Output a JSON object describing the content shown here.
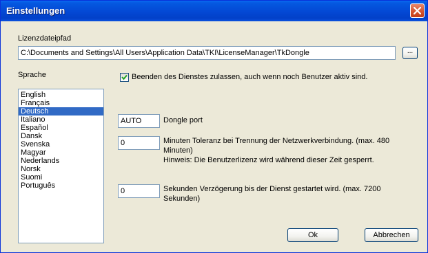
{
  "window": {
    "title": "Einstellungen"
  },
  "license": {
    "label": "Lizenzdateipfad",
    "path": "C:\\Documents and Settings\\All Users\\Application Data\\TKI\\LicenseManager\\TkDongle",
    "browse_label": "..."
  },
  "language": {
    "label": "Sprache",
    "items": [
      {
        "label": "English",
        "selected": false
      },
      {
        "label": "Français",
        "selected": false
      },
      {
        "label": "Deutsch",
        "selected": true
      },
      {
        "label": "Italiano",
        "selected": false
      },
      {
        "label": "Español",
        "selected": false
      },
      {
        "label": "Dansk",
        "selected": false
      },
      {
        "label": "Svenska",
        "selected": false
      },
      {
        "label": "Magyar",
        "selected": false
      },
      {
        "label": "Nederlands",
        "selected": false
      },
      {
        "label": "Norsk",
        "selected": false
      },
      {
        "label": "Suomi",
        "selected": false
      },
      {
        "label": "Português",
        "selected": false
      }
    ]
  },
  "options": {
    "allow_stop": {
      "label": "Beenden des Dienstes zulassen, auch wenn noch Benutzer aktiv sind.",
      "checked": true
    },
    "dongle_port": {
      "value": "AUTO",
      "label": "Dongle port"
    },
    "tolerance": {
      "value": "0",
      "line1": "Minuten Toleranz bei Trennung der Netzwerkverbindung. (max. 480",
      "line2": "Minuten)",
      "line3": "Hinweis: Die Benutzerlizenz wird während dieser Zeit gesperrt."
    },
    "delay": {
      "value": "0",
      "line1": "Sekunden Verzögerung bis der Dienst gestartet wird. (max. 7200",
      "line2": "Sekunden)"
    }
  },
  "buttons": {
    "ok": "Ok",
    "cancel": "Abbrechen"
  },
  "colors": {
    "titlebar": "#0348d4",
    "selection": "#316ac5",
    "dialog_bg": "#ece9d8",
    "close": "#d5542f"
  }
}
